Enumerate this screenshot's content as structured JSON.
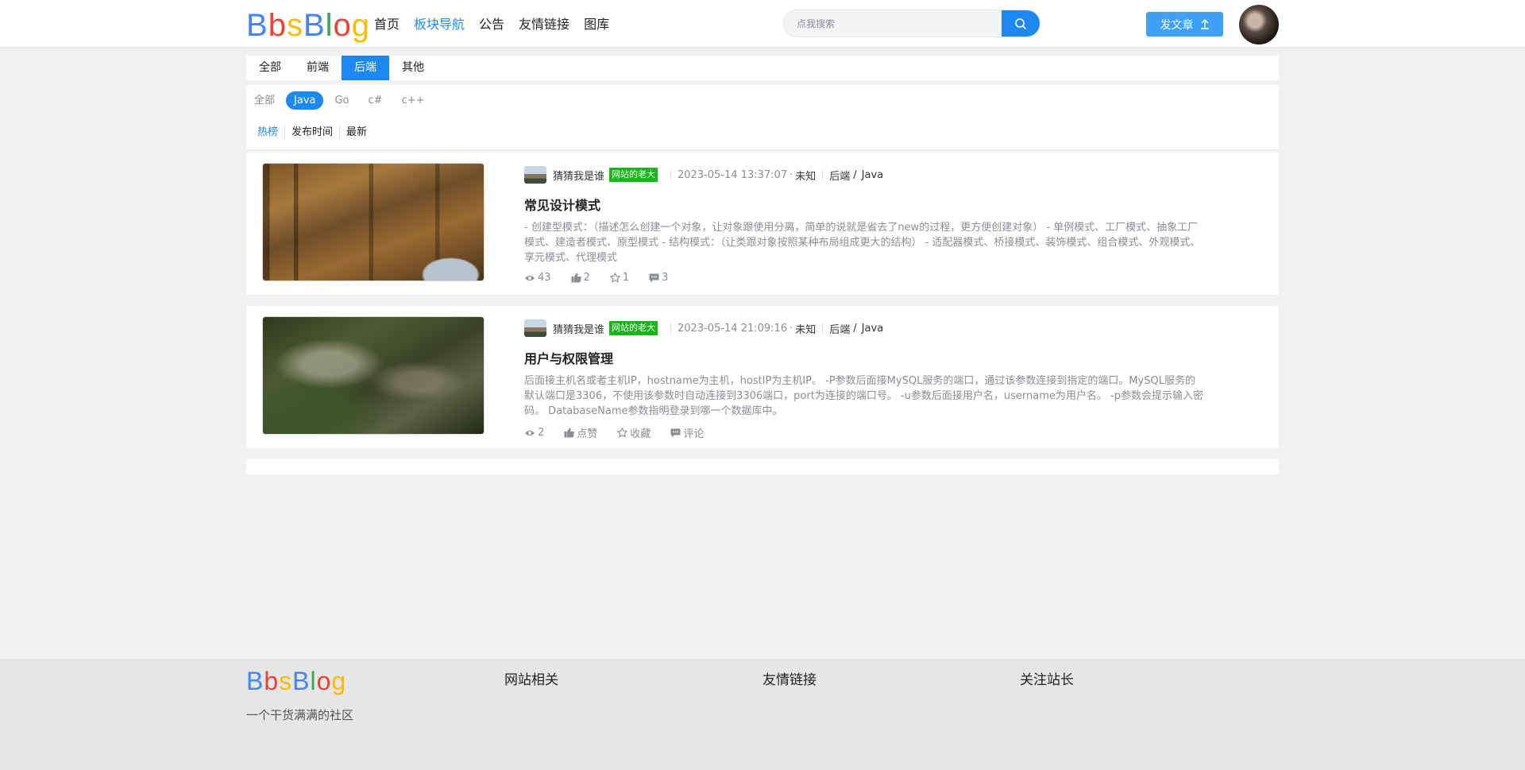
{
  "brand": {
    "letters": [
      {
        "ch": "B",
        "color": "#4285f4"
      },
      {
        "ch": "b",
        "color": "#ea4335"
      },
      {
        "ch": "s",
        "color": "#fbbc05"
      },
      {
        "ch": "B",
        "color": "#4285f4"
      },
      {
        "ch": "l",
        "color": "#34a853"
      },
      {
        "ch": "o",
        "color": "#ea4335"
      },
      {
        "ch": "g",
        "color": "#fbbc05"
      }
    ]
  },
  "nav": [
    "首页",
    "板块导航",
    "公告",
    "友情链接",
    "图库"
  ],
  "nav_active_index": 1,
  "search": {
    "placeholder": "点我搜索"
  },
  "post_button": {
    "label": "发文章"
  },
  "category_tabs": [
    "全部",
    "前端",
    "后端",
    "其他"
  ],
  "category_active_index": 2,
  "sub_tags": [
    "全部",
    "Java",
    "Go",
    "c#",
    "c++"
  ],
  "sub_tag_active_index": 1,
  "sorts": [
    "热榜",
    "发布时间",
    "最新"
  ],
  "sort_active_index": 0,
  "articles": [
    {
      "author": "猜猜我是谁",
      "badge": "网站的老大",
      "date": "2023-05-14 13:37:07",
      "location": "未知",
      "category": "后端",
      "sub_category": "Java",
      "title": "常见设计模式",
      "summary": "- 创建型模式：（描述怎么创建一个对象，让对象跟使用分离，简单的说就是省去了new的过程，更方便创建对象） - 单例模式、工厂模式、抽象工厂模式、建造者模式、原型模式 - 结构模式：（让类跟对象按照某种布局组成更大的结构） - 适配器模式、桥接模式、装饰模式、组合模式、外观模式、享元模式、代理模式",
      "views": "43",
      "likes": "2",
      "favorites": "1",
      "comments": "3"
    },
    {
      "author": "猜猜我是谁",
      "badge": "网站的老大",
      "date": "2023-05-14 21:09:16",
      "location": "未知",
      "category": "后端",
      "sub_category": "Java",
      "title": "用户与权限管理",
      "summary": "后面接主机名或者主机IP，hostname为主机，hostIP为主机IP。 -P参数后面接MySQL服务的端口，通过该参数连接到指定的端口。MySQL服务的默认端口是3306，不使用该参数时自动连接到3306端口，port为连接的端口号。 -u参数后面接用户名，username为用户名。 -p参数会提示输入密码。 DatabaseName参数指明登录到哪一个数据库中。",
      "views": "2",
      "likes": "点赞",
      "favorites": "收藏",
      "comments": "评论"
    }
  ],
  "footer": {
    "slogan": "一个干货满满的社区",
    "columns": [
      "网站相关",
      "友情链接",
      "关注站长"
    ]
  },
  "colors": {
    "accent": "#1e88f2",
    "badge": "#19b619"
  }
}
